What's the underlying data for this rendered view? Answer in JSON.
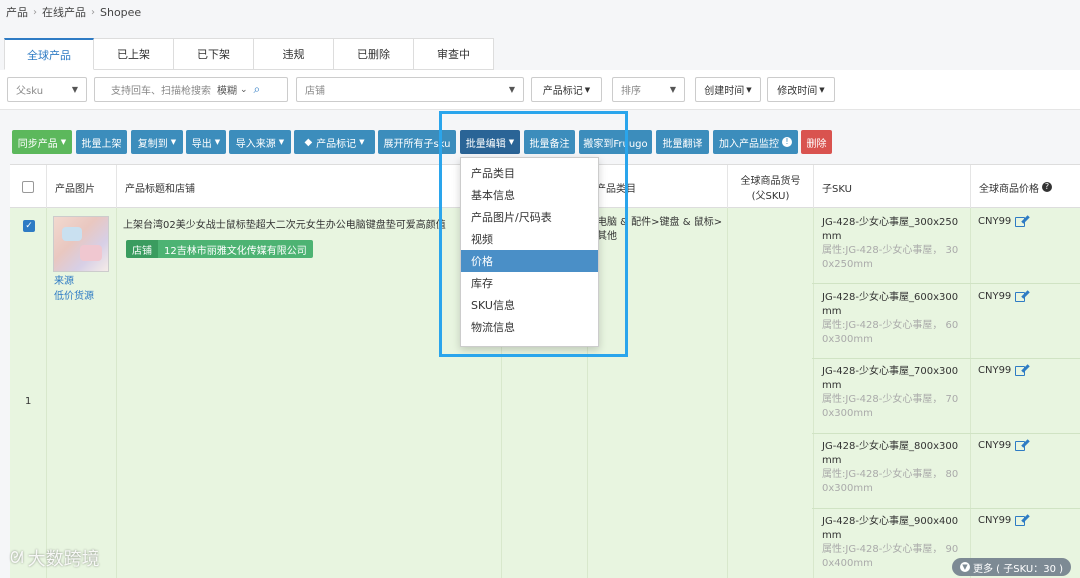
{
  "breadcrumb": [
    "产品",
    "在线产品",
    "Shopee"
  ],
  "tabs": [
    "全球产品",
    "已上架",
    "已下架",
    "违规",
    "已删除",
    "审查中"
  ],
  "filters": {
    "parent_sku": "父sku",
    "search_placeholder": "支持回车、扫描枪搜索",
    "fuzzy": "模糊",
    "shop": "店铺",
    "product_tag": "产品标记",
    "sort": "排序",
    "created_time": "创建时间",
    "modified_time": "修改时间"
  },
  "toolbar": {
    "sync": "同步产品",
    "bulk_list": "批量上架",
    "copy_to": "复制到",
    "export": "导出",
    "import_source": "导入来源",
    "product_tag": "产品标记",
    "expand_sku": "展开所有子sku",
    "bulk_edit": "批量编辑",
    "bulk_note": "批量备注",
    "move_to_fruugo": "搬家到Fruugo",
    "bulk_translate": "批量翻译",
    "add_monitor": "加入产品监控",
    "delete": "删除"
  },
  "columns": {
    "image": "产品图片",
    "title": "产品标题和店铺",
    "category": "产品类目",
    "global_sku_line1": "全球商品货号",
    "global_sku_line2": "(父SKU)",
    "child_sku": "子SKU",
    "global_price": "全球商品价格"
  },
  "dropdown": [
    "产品类目",
    "基本信息",
    "产品图片/尺码表",
    "视频",
    "价格",
    "库存",
    "SKU信息",
    "物流信息"
  ],
  "row": {
    "index": "1",
    "source_link": "来源",
    "low_price_link": "低价货源",
    "title": "上架台湾02美少女战士鼠标垫超大二次元女生办公电脑键盘垫可爱高颜值",
    "shop_label": "店铺",
    "shop_name": "12吉林市丽雅文化传媒有限公司",
    "category_line1": "电脑 & 配件>键盘 & 鼠标>",
    "category_line2": "其他",
    "skus": [
      {
        "l1": "JG-428-少女心事屋_300x250",
        "l2": "mm",
        "a1": "属性:JG-428-少女心事屋， 30",
        "a2": "0x250mm",
        "price": "CNY99"
      },
      {
        "l1": "JG-428-少女心事屋_600x300",
        "l2": "mm",
        "a1": "属性:JG-428-少女心事屋， 60",
        "a2": "0x300mm",
        "price": "CNY99"
      },
      {
        "l1": "JG-428-少女心事屋_700x300",
        "l2": "mm",
        "a1": "属性:JG-428-少女心事屋， 70",
        "a2": "0x300mm",
        "price": "CNY99"
      },
      {
        "l1": "JG-428-少女心事屋_800x300",
        "l2": "mm",
        "a1": "属性:JG-428-少女心事屋， 80",
        "a2": "0x300mm",
        "price": "CNY99"
      },
      {
        "l1": "JG-428-少女心事屋_900x400",
        "l2": "mm",
        "a1": "属性:JG-428-少女心事屋， 90",
        "a2": "0x400mm",
        "price": "CNY99"
      }
    ],
    "more": "更多 ( 子SKU：30 )"
  },
  "watermark": "大数跨境"
}
